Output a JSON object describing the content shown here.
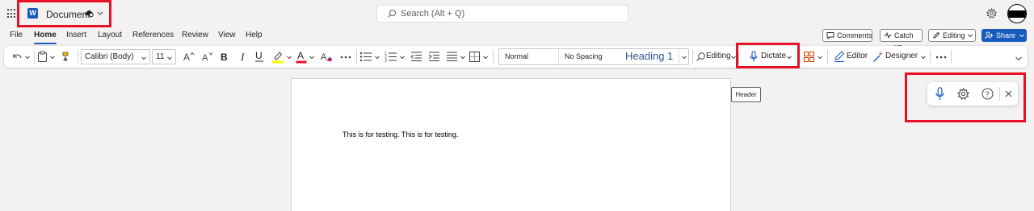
{
  "titlebar": {
    "app_icon_letter": "W",
    "document_title": "Document",
    "search_placeholder": "Search (Alt + Q)"
  },
  "menu": {
    "tabs": [
      {
        "label": "File"
      },
      {
        "label": "Home",
        "active": true
      },
      {
        "label": "Insert"
      },
      {
        "label": "Layout"
      },
      {
        "label": "References"
      },
      {
        "label": "Review"
      },
      {
        "label": "View"
      },
      {
        "label": "Help"
      }
    ],
    "comments_label": "Comments",
    "catchup_label": "Catch up",
    "editing_label": "Editing",
    "share_label": "Share"
  },
  "ribbon": {
    "font_name": "Calibri (Body)",
    "font_size": "11",
    "styles": [
      {
        "label": "Normal"
      },
      {
        "label": "No Spacing"
      },
      {
        "label": "Heading 1"
      }
    ],
    "editing_label": "Editing",
    "dictate_label": "Dictate",
    "editor_label": "Editor",
    "designer_label": "Designer"
  },
  "document": {
    "body_text": "This is for testing. This is for testing."
  },
  "tooltip": {
    "text": "Header"
  },
  "colors": {
    "accent": "#185abd",
    "highlight": "#e81123",
    "highlight_yellow": "#ffff00",
    "font_color_red": "#e81123"
  }
}
